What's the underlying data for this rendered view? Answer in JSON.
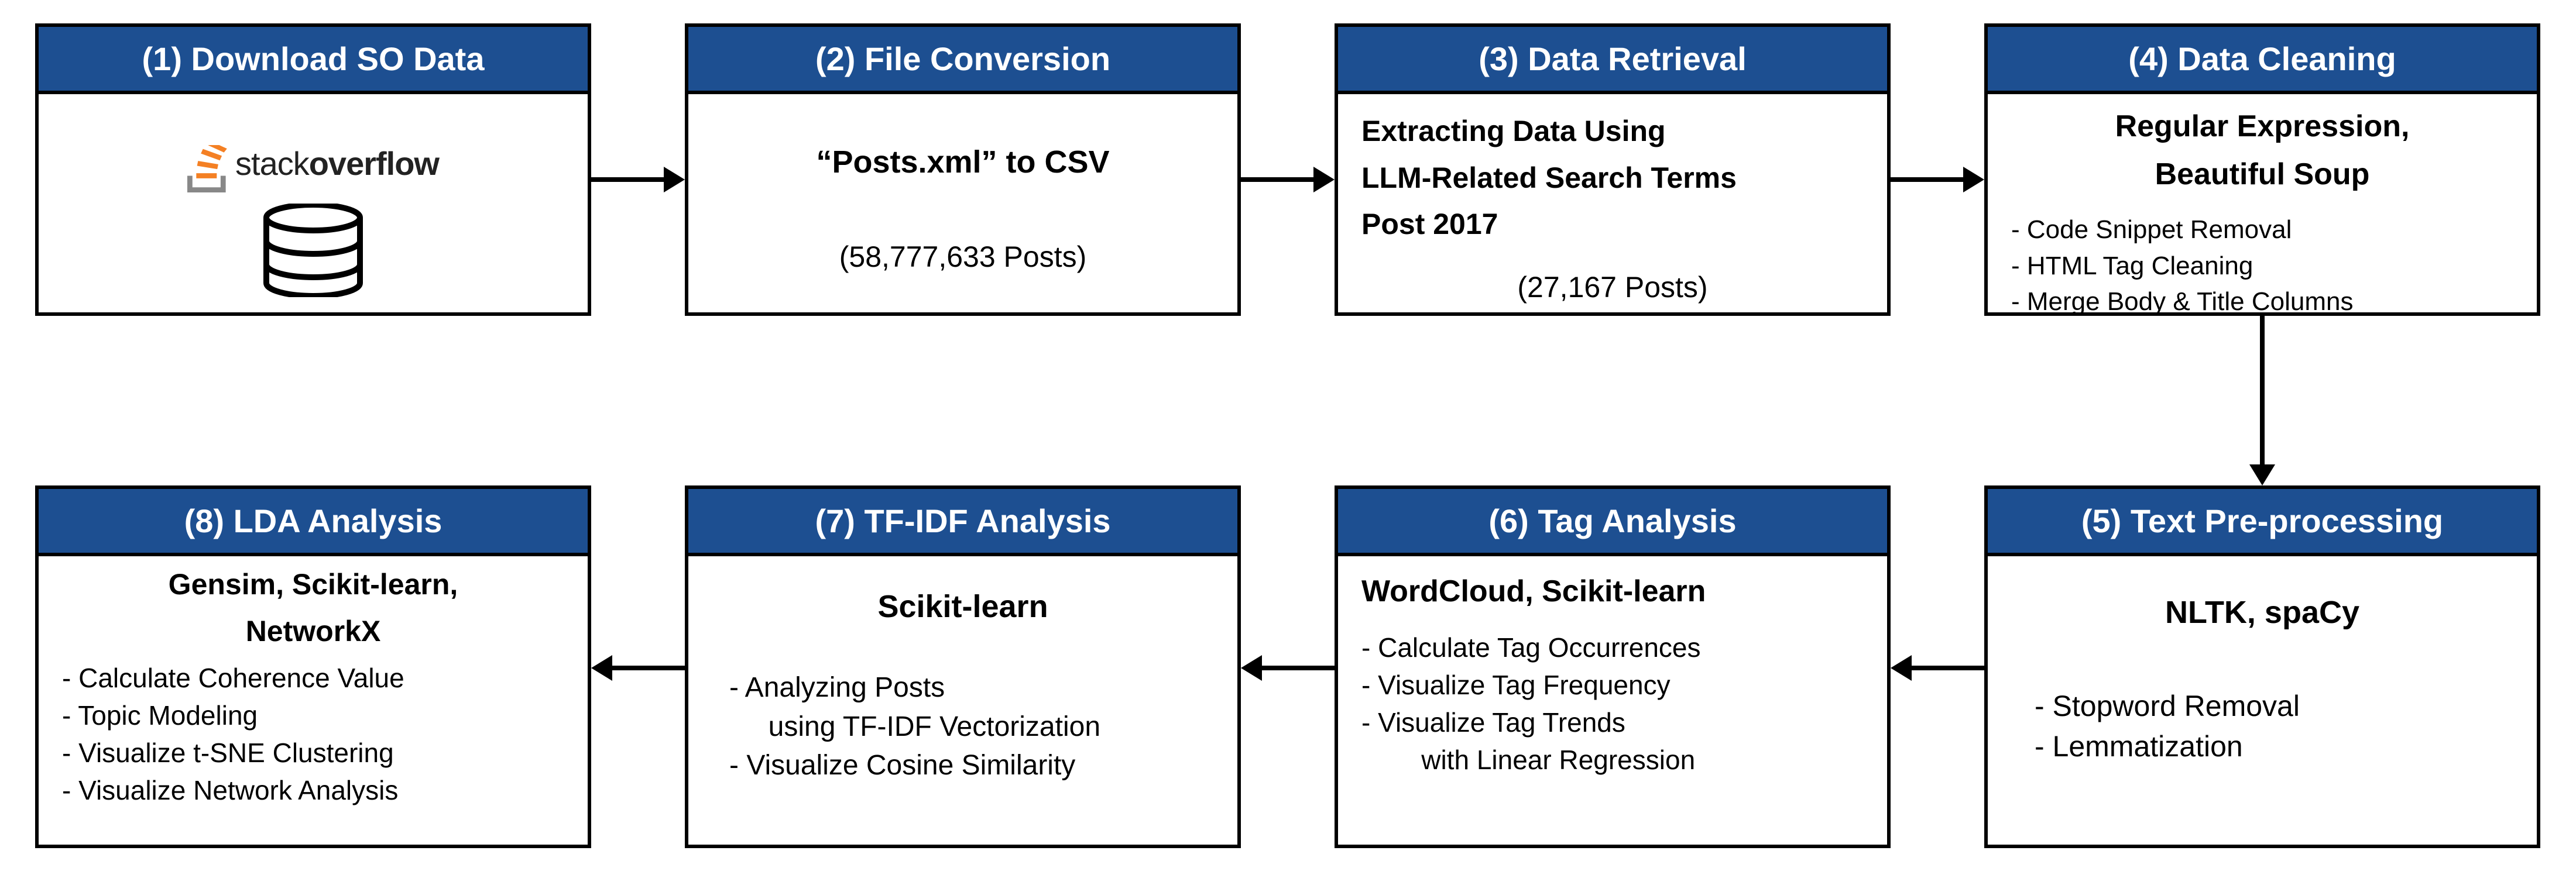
{
  "boxes": {
    "b1": {
      "title": "(1) Download SO Data",
      "brand_stack": "stack",
      "brand_overflow": "overflow"
    },
    "b2": {
      "title": "(2) File Conversion",
      "main": "“Posts.xml” to CSV",
      "count": "(58,777,633 Posts)"
    },
    "b3": {
      "title": "(3) Data Retrieval",
      "main_l1": "Extracting Data Using",
      "main_l2": "LLM-Related Search Terms",
      "main_l3": "Post 2017",
      "count": "(27,167 Posts)"
    },
    "b4": {
      "title": "(4) Data Cleaning",
      "main_l1": "Regular Expression,",
      "main_l2": "Beautiful Soup",
      "item1": "- Code Snippet Removal",
      "item2": "- HTML Tag Cleaning",
      "item3": "- Merge Body & Title Columns"
    },
    "b5": {
      "title": "(5) Text Pre-processing",
      "main": "NLTK, spaCy",
      "item1": "- Stopword Removal",
      "item2": "- Lemmatization"
    },
    "b6": {
      "title": "(6) Tag Analysis",
      "main": "WordCloud, Scikit-learn",
      "item1": "- Calculate Tag Occurrences",
      "item2": "- Visualize Tag Frequency",
      "item3": "- Visualize Tag Trends",
      "item3b": "        with Linear Regression"
    },
    "b7": {
      "title": "(7) TF-IDF Analysis",
      "main": "Scikit-learn",
      "item1": "- Analyzing Posts",
      "item1b": "     using TF-IDF Vectorization",
      "item2": "- Visualize Cosine Similarity"
    },
    "b8": {
      "title": "(8) LDA Analysis",
      "main_l1": "Gensim, Scikit-learn,",
      "main_l2": "NetworkX",
      "item1": "- Calculate Coherence Value",
      "item2": "- Topic Modeling",
      "item3": "- Visualize t-SNE Clustering",
      "item4": "- Visualize Network Analysis"
    }
  },
  "chart_data": {
    "type": "flowchart",
    "nodes": [
      {
        "id": 1,
        "label": "(1) Download SO Data",
        "detail": "stackoverflow data dump (database)"
      },
      {
        "id": 2,
        "label": "(2) File Conversion",
        "detail": "\"Posts.xml\" to CSV",
        "posts": 58777633
      },
      {
        "id": 3,
        "label": "(3) Data Retrieval",
        "detail": "Extracting Data Using LLM-Related Search Terms Post 2017",
        "posts": 27167
      },
      {
        "id": 4,
        "label": "(4) Data Cleaning",
        "tools": [
          "Regular Expression",
          "Beautiful Soup"
        ],
        "steps": [
          "Code Snippet Removal",
          "HTML Tag Cleaning",
          "Merge Body & Title Columns"
        ]
      },
      {
        "id": 5,
        "label": "(5) Text Pre-processing",
        "tools": [
          "NLTK",
          "spaCy"
        ],
        "steps": [
          "Stopword Removal",
          "Lemmatization"
        ]
      },
      {
        "id": 6,
        "label": "(6) Tag Analysis",
        "tools": [
          "WordCloud",
          "Scikit-learn"
        ],
        "steps": [
          "Calculate Tag Occurrences",
          "Visualize Tag Frequency",
          "Visualize Tag Trends with Linear Regression"
        ]
      },
      {
        "id": 7,
        "label": "(7) TF-IDF Analysis",
        "tools": [
          "Scikit-learn"
        ],
        "steps": [
          "Analyzing Posts using TF-IDF Vectorization",
          "Visualize Cosine Similarity"
        ]
      },
      {
        "id": 8,
        "label": "(8) LDA Analysis",
        "tools": [
          "Gensim",
          "Scikit-learn",
          "NetworkX"
        ],
        "steps": [
          "Calculate Coherence Value",
          "Topic Modeling",
          "Visualize t-SNE Clustering",
          "Visualize Network Analysis"
        ]
      }
    ],
    "edges": [
      {
        "from": 1,
        "to": 2
      },
      {
        "from": 2,
        "to": 3
      },
      {
        "from": 3,
        "to": 4
      },
      {
        "from": 4,
        "to": 5
      },
      {
        "from": 5,
        "to": 6
      },
      {
        "from": 6,
        "to": 7
      },
      {
        "from": 7,
        "to": 8
      }
    ]
  }
}
